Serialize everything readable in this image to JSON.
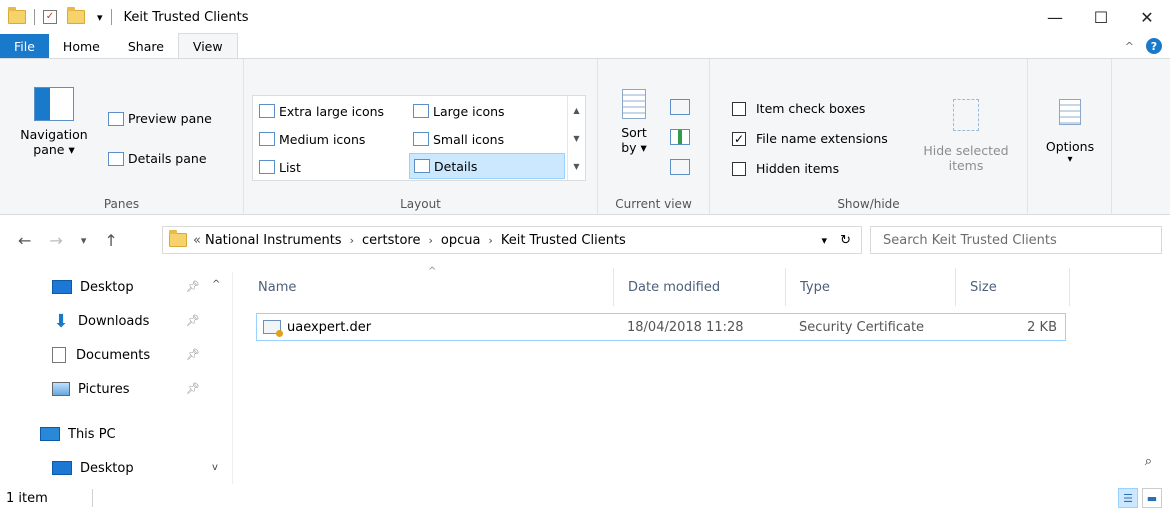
{
  "window": {
    "title": "Keit Trusted Clients"
  },
  "title_controls": {
    "minimize": "—",
    "maximize": "☐",
    "close": "✕"
  },
  "tabs": [
    {
      "label": "File"
    },
    {
      "label": "Home"
    },
    {
      "label": "Share"
    },
    {
      "label": "View"
    }
  ],
  "ribbon": {
    "panes": {
      "label": "Panes",
      "navigation_pane": "Navigation",
      "navigation_pane_sub": "pane ▾",
      "preview_pane": "Preview pane",
      "details_pane": "Details pane"
    },
    "layout": {
      "label": "Layout",
      "items": [
        "Extra large icons",
        "Large icons",
        "Medium icons",
        "Small icons",
        "List",
        "Details"
      ],
      "selected": "Details"
    },
    "current_view": {
      "label": "Current view",
      "sort": "Sort",
      "sort_sub": "by ▾"
    },
    "show_hide": {
      "label": "Show/hide",
      "item_check_boxes": "Item check boxes",
      "file_name_extensions": "File name extensions",
      "hidden_items": "Hidden items",
      "hide_selected": "Hide selected",
      "hide_selected_sub": "items",
      "checks": {
        "item_check_boxes": false,
        "file_name_extensions": true,
        "hidden_items": false
      }
    },
    "options": {
      "label": "Options",
      "sub": "▾"
    }
  },
  "address": {
    "prefix": "«",
    "crumbs": [
      "National Instruments",
      "certstore",
      "opcua",
      "Keit Trusted Clients"
    ],
    "search_placeholder": "Search Keit Trusted Clients"
  },
  "nav": {
    "items": [
      "Desktop",
      "Downloads",
      "Documents",
      "Pictures",
      "This PC",
      "Desktop"
    ]
  },
  "columns": [
    "Name",
    "Date modified",
    "Type",
    "Size"
  ],
  "files": [
    {
      "name": "uaexpert.der",
      "date_modified": "18/04/2018 11:28",
      "type": "Security Certificate",
      "size": "2 KB"
    }
  ],
  "status": {
    "count": "1 item"
  }
}
